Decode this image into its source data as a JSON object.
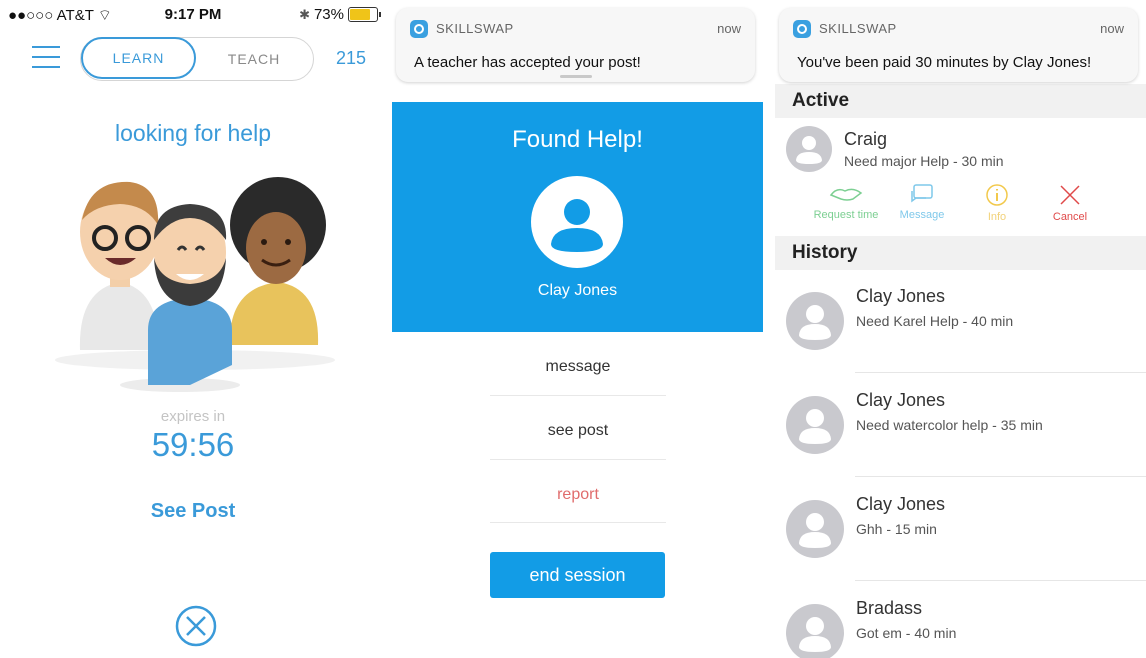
{
  "screen1": {
    "status": {
      "carrier": "●●○○○ AT&T",
      "time": "9:17 PM",
      "battery": "73%"
    },
    "toggle": {
      "learn": "LEARN",
      "teach": "TEACH"
    },
    "credits": "215",
    "looking": "looking for help",
    "expires_label": "expires in",
    "timer": "59:56",
    "see_post": "See Post"
  },
  "screen2": {
    "notification": {
      "app": "SKILLSWAP",
      "when": "now",
      "message": "A teacher has accepted your post!"
    },
    "found_title": "Found Help!",
    "teacher_name": "Clay Jones",
    "options": {
      "message": "message",
      "see_post": "see post",
      "report": "report"
    },
    "end_session": "end session"
  },
  "screen3": {
    "notification": {
      "app": "SKILLSWAP",
      "when": "now",
      "message": "You've been paid 30 minutes by Clay Jones!"
    },
    "active_header": "Active",
    "active": {
      "name": "Craig",
      "desc": "Need major Help - 30 min"
    },
    "actions": {
      "request": "Request time",
      "message": "Message",
      "info": "Info",
      "cancel": "Cancel"
    },
    "history_header": "History",
    "history": [
      {
        "name": "Clay Jones",
        "desc": "Need Karel Help - 40 min"
      },
      {
        "name": "Clay Jones",
        "desc": "Need watercolor help - 35 min"
      },
      {
        "name": "Clay Jones",
        "desc": "Ghh - 15 min"
      },
      {
        "name": "Bradass",
        "desc": "Got em - 40 min"
      }
    ]
  },
  "colors": {
    "accent": "#3a9ad9",
    "panel_blue": "#129ce6",
    "report_red": "#e06c6c",
    "cancel_red": "#e04a4a",
    "request_green": "#7ccf92",
    "info_yellow": "#f2c94c"
  },
  "icons": [
    "hamburger-icon",
    "close-circle-icon",
    "user-icon",
    "handshake-icon",
    "chat-icon",
    "info-icon",
    "cancel-x-icon",
    "skillswap-app-icon",
    "battery-icon",
    "bluetooth-icon",
    "wifi-icon"
  ]
}
